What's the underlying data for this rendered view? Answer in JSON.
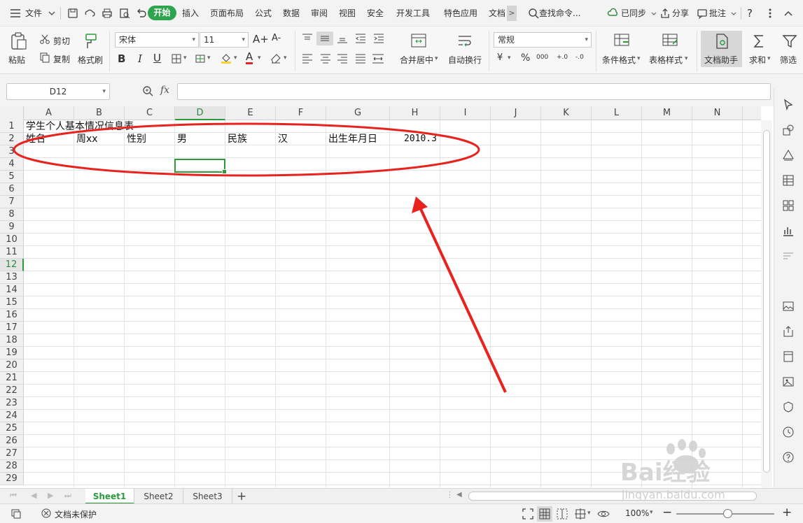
{
  "menu": {
    "file_label": "文件",
    "tabs": [
      "开始",
      "插入",
      "页面布局",
      "公式",
      "数据",
      "审阅",
      "视图",
      "安全",
      "开发工具",
      "特色应用",
      "文档"
    ],
    "more_glyph": ">",
    "search_label": "查找命令...",
    "sync_label": "已同步",
    "share_label": "分享",
    "comment_label": "批注",
    "help_glyph": "?"
  },
  "ribbon": {
    "paste_label": "粘贴",
    "cut_label": "剪切",
    "copy_label": "复制",
    "format_painter_label": "格式刷",
    "font_name": "宋体",
    "font_size": "11",
    "number_format": "常规",
    "merge_center_label": "合并居中",
    "wrap_text_label": "自动换行",
    "cond_format_label": "条件格式",
    "table_style_label": "表格样式",
    "doc_assistant_label": "文档助手",
    "sum_label": "求和",
    "filter_label": "筛选",
    "bold_glyph": "B",
    "italic_glyph": "I",
    "underline_glyph": "U",
    "grow_font_glyph": "A+",
    "shrink_font_glyph": "A-",
    "font_color_glyph": "A",
    "currency_glyph": "¥",
    "percent_glyph": "%",
    "thousands_glyph": "000",
    "dec_inc_glyph": "+.0",
    "dec_dec_glyph": "-.0"
  },
  "formula_bar": {
    "name_box": "D12",
    "fx_glyph": "fx",
    "formula": ""
  },
  "grid": {
    "columns": [
      "A",
      "B",
      "C",
      "D",
      "E",
      "F",
      "G",
      "H",
      "I",
      "J",
      "K",
      "L",
      "M",
      "N"
    ],
    "rows": [
      "1",
      "2",
      "3",
      "4",
      "5",
      "6",
      "7",
      "8",
      "9",
      "10",
      "11",
      "12",
      "13",
      "14",
      "15",
      "16",
      "17",
      "18",
      "19",
      "20",
      "21",
      "22",
      "23",
      "24",
      "25",
      "26",
      "27",
      "28",
      "29"
    ],
    "selected_column": "D",
    "selected_row": "12",
    "cells": {
      "A1": "学生个人基本情况信息表",
      "A2": "姓名",
      "B2": "周xx",
      "C2": "性别",
      "D2": "男",
      "E2": "民族",
      "F2": "汉",
      "G2": "出生年月日",
      "H2": "2010.3"
    }
  },
  "sheets": {
    "tabs": [
      "Sheet1",
      "Sheet2",
      "Sheet3"
    ],
    "active": "Sheet1",
    "add_glyph": "+"
  },
  "status": {
    "protect_label": "文档未保护",
    "zoom": "100%",
    "zoom_minus": "−",
    "zoom_plus": "+",
    "zoom_level": 1.0
  },
  "watermark": {
    "brand": "Bai经验",
    "url": "jingyan.baidu.com"
  },
  "colors": {
    "accent_green": "#2ea44f",
    "annotation_red": "#e8231e"
  }
}
